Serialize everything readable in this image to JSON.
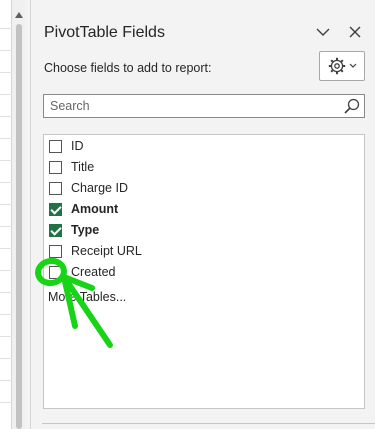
{
  "pane": {
    "title": "PivotTable Fields",
    "choose_label": "Choose fields to add to report:",
    "search_placeholder": "Search",
    "fields": [
      {
        "label": "ID",
        "checked": false
      },
      {
        "label": "Title",
        "checked": false
      },
      {
        "label": "Charge ID",
        "checked": false
      },
      {
        "label": "Amount",
        "checked": true
      },
      {
        "label": "Type",
        "checked": true
      },
      {
        "label": "Receipt URL",
        "checked": false
      },
      {
        "label": "Created",
        "checked": false
      }
    ],
    "more_tables": "More Tables..."
  },
  "icons": [
    "chevron-down-icon",
    "close-icon",
    "gear-icon",
    "search-icon",
    "checkbox-icon"
  ],
  "colors": {
    "accent": "#217346",
    "annotation": "#17d417",
    "pane_bg": "#f3f3f3"
  }
}
